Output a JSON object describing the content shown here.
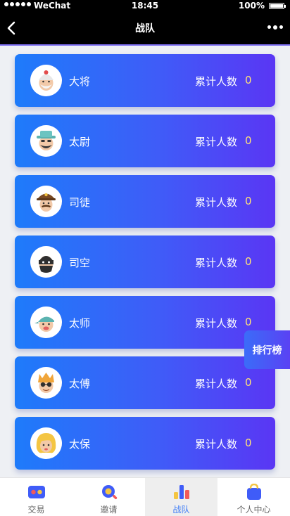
{
  "status_bar": {
    "carrier": "WeChat",
    "time": "18:45",
    "battery": "100%"
  },
  "nav": {
    "title": "战队"
  },
  "ranks": [
    {
      "name": "大将",
      "count_label": "累计人数",
      "count": "0",
      "avatar_icon": "general-avatar-icon"
    },
    {
      "name": "太尉",
      "count_label": "累计人数",
      "count": "0",
      "avatar_icon": "cowboy-avatar-icon"
    },
    {
      "name": "司徒",
      "count_label": "累计人数",
      "count": "0",
      "avatar_icon": "sheriff-avatar-icon"
    },
    {
      "name": "司空",
      "count_label": "累计人数",
      "count": "0",
      "avatar_icon": "masked-avatar-icon"
    },
    {
      "name": "太师",
      "count_label": "累计人数",
      "count": "0",
      "avatar_icon": "cap-avatar-icon"
    },
    {
      "name": "太傅",
      "count_label": "累计人数",
      "count": "0",
      "avatar_icon": "glasses-avatar-icon"
    },
    {
      "name": "太保",
      "count_label": "累计人数",
      "count": "0",
      "avatar_icon": "blonde-avatar-icon"
    }
  ],
  "leaderboard_label": "排行榜",
  "tabs": [
    {
      "label": "交易",
      "icon": "trade-icon",
      "active": false
    },
    {
      "label": "邀请",
      "icon": "invite-search-icon",
      "active": false
    },
    {
      "label": "战队",
      "icon": "team-chart-icon",
      "active": true
    },
    {
      "label": "个人中心",
      "icon": "profile-bag-icon",
      "active": false
    }
  ],
  "colors": {
    "accent": "#3a7af7",
    "card_start": "#1e7bfa",
    "card_end": "#5a36f4",
    "count_color": "#ffe27a"
  }
}
